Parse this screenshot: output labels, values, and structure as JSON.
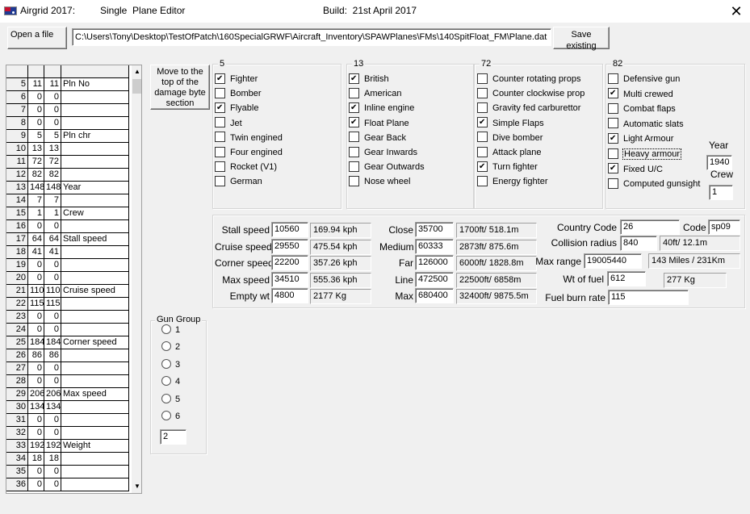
{
  "window": {
    "app": "Airgrid 2017:",
    "subtitle": "Single  Plane Editor",
    "build": "Build:  21st April 2017",
    "close_glyph": "✕"
  },
  "toolbar": {
    "open_label": "Open a file",
    "path": "C:\\Users\\Tony\\Desktop\\TestOfPatch\\160SpecialGRWF\\Aircraft_Inventory\\SPAWPlanes\\FMs\\140SpitFloat_FM\\Plane.dat",
    "save_label": "Save existing"
  },
  "damage_button": "Move to the top of the damage byte section",
  "grid": {
    "rows": [
      {
        "n": "5",
        "a": "11",
        "b": "11",
        "label": "Pln No"
      },
      {
        "n": "6",
        "a": "0",
        "b": "0",
        "label": ""
      },
      {
        "n": "7",
        "a": "0",
        "b": "0",
        "label": ""
      },
      {
        "n": "8",
        "a": "0",
        "b": "0",
        "label": ""
      },
      {
        "n": "9",
        "a": "5",
        "b": "5",
        "label": "Pln chr"
      },
      {
        "n": "10",
        "a": "13",
        "b": "13",
        "label": ""
      },
      {
        "n": "11",
        "a": "72",
        "b": "72",
        "label": ""
      },
      {
        "n": "12",
        "a": "82",
        "b": "82",
        "label": ""
      },
      {
        "n": "13",
        "a": "148",
        "b": "148",
        "label": "Year"
      },
      {
        "n": "14",
        "a": "7",
        "b": "7",
        "label": ""
      },
      {
        "n": "15",
        "a": "1",
        "b": "1",
        "label": "Crew"
      },
      {
        "n": "16",
        "a": "0",
        "b": "0",
        "label": ""
      },
      {
        "n": "17",
        "a": "64",
        "b": "64",
        "label": "Stall speed"
      },
      {
        "n": "18",
        "a": "41",
        "b": "41",
        "label": ""
      },
      {
        "n": "19",
        "a": "0",
        "b": "0",
        "label": ""
      },
      {
        "n": "20",
        "a": "0",
        "b": "0",
        "label": ""
      },
      {
        "n": "21",
        "a": "110",
        "b": "110",
        "label": "Cruise speed"
      },
      {
        "n": "22",
        "a": "115",
        "b": "115",
        "label": ""
      },
      {
        "n": "23",
        "a": "0",
        "b": "0",
        "label": ""
      },
      {
        "n": "24",
        "a": "0",
        "b": "0",
        "label": ""
      },
      {
        "n": "25",
        "a": "184",
        "b": "184",
        "label": "Corner speed"
      },
      {
        "n": "26",
        "a": "86",
        "b": "86",
        "label": ""
      },
      {
        "n": "27",
        "a": "0",
        "b": "0",
        "label": ""
      },
      {
        "n": "28",
        "a": "0",
        "b": "0",
        "label": ""
      },
      {
        "n": "29",
        "a": "206",
        "b": "206",
        "label": "Max speed"
      },
      {
        "n": "30",
        "a": "134",
        "b": "134",
        "label": ""
      },
      {
        "n": "31",
        "a": "0",
        "b": "0",
        "label": ""
      },
      {
        "n": "32",
        "a": "0",
        "b": "0",
        "label": ""
      },
      {
        "n": "33",
        "a": "192",
        "b": "192",
        "label": "Weight"
      },
      {
        "n": "34",
        "a": "18",
        "b": "18",
        "label": ""
      },
      {
        "n": "35",
        "a": "0",
        "b": "0",
        "label": ""
      },
      {
        "n": "36",
        "a": "0",
        "b": "0",
        "label": ""
      }
    ]
  },
  "groups": {
    "g5": {
      "title": "5",
      "items": [
        {
          "label": "Fighter",
          "checked": true
        },
        {
          "label": "Bomber",
          "checked": false
        },
        {
          "label": "Flyable",
          "checked": true
        },
        {
          "label": "Jet",
          "checked": false
        },
        {
          "label": "Twin engined",
          "checked": false
        },
        {
          "label": "Four engined",
          "checked": false
        },
        {
          "label": "Rocket (V1)",
          "checked": false
        },
        {
          "label": "German",
          "checked": false
        }
      ]
    },
    "g13": {
      "title": "13",
      "items": [
        {
          "label": "British",
          "checked": true
        },
        {
          "label": "American",
          "checked": false
        },
        {
          "label": "Inline engine",
          "checked": true
        },
        {
          "label": "Float Plane",
          "checked": true
        },
        {
          "label": "Gear Back",
          "checked": false
        },
        {
          "label": "Gear Inwards",
          "checked": false
        },
        {
          "label": "Gear Outwards",
          "checked": false
        },
        {
          "label": "Nose wheel",
          "checked": false
        }
      ]
    },
    "g72": {
      "title": "72",
      "items": [
        {
          "label": "Counter rotating props",
          "checked": false
        },
        {
          "label": "Counter clockwise prop",
          "checked": false
        },
        {
          "label": "Gravity fed carburettor",
          "checked": false
        },
        {
          "label": "Simple Flaps",
          "checked": true
        },
        {
          "label": "Dive bomber",
          "checked": false
        },
        {
          "label": "Attack plane",
          "checked": false
        },
        {
          "label": "Turn fighter",
          "checked": true
        },
        {
          "label": "Energy fighter",
          "checked": false
        }
      ]
    },
    "g82": {
      "title": "82",
      "items": [
        {
          "label": "Defensive gun",
          "checked": false
        },
        {
          "label": "Multi crewed",
          "checked": true
        },
        {
          "label": "Combat flaps",
          "checked": false
        },
        {
          "label": "Automatic slats",
          "checked": false
        },
        {
          "label": "Light Armour",
          "checked": true
        },
        {
          "label": "Heavy armour",
          "checked": false
        },
        {
          "label": "Fixed U/C",
          "checked": true
        },
        {
          "label": "Computed gunsight",
          "checked": false
        }
      ],
      "year_label": "Year",
      "year_value": "1940",
      "crew_label": "Crew",
      "crew_value": "1"
    }
  },
  "performance": {
    "speeds": [
      {
        "label": "Stall speed",
        "value": "10560",
        "conv": "169.94 kph"
      },
      {
        "label": "Cruise speed",
        "value": "29550",
        "conv": "475.54 kph"
      },
      {
        "label": "Corner speed",
        "value": "22200",
        "conv": "357.26 kph"
      },
      {
        "label": "Max speed",
        "value": "34510",
        "conv": "555.36 kph"
      },
      {
        "label": "Empty wt",
        "value": "4800",
        "conv": "2177 Kg"
      }
    ],
    "ranges": [
      {
        "label": "Close",
        "value": "35700",
        "conv": "1700ft/ 518.1m"
      },
      {
        "label": "Medium",
        "value": "60333",
        "conv": "2873ft/ 875.6m"
      },
      {
        "label": "Far",
        "value": "126000",
        "conv": "6000ft/ 1828.8m"
      },
      {
        "label": "Line",
        "value": "472500",
        "conv": "22500ft/ 6858m"
      },
      {
        "label": "Max",
        "value": "680400",
        "conv": "32400ft/ 9875.5m"
      }
    ],
    "country_label": "Country Code",
    "country_value": "26",
    "code_label": "Code",
    "code_value": "sp09",
    "collision_label": "Collision radius",
    "collision_value": "840",
    "collision_conv": "40ft/ 12.1m",
    "maxrange_label": "Max range",
    "maxrange_value": "19005440",
    "maxrange_conv": "143 Miles / 231Km",
    "fuel_label": "Wt of fuel",
    "fuel_value": "612",
    "fuel_conv": "277 Kg",
    "burn_label": "Fuel burn rate",
    "burn_value": "115"
  },
  "gun_group": {
    "title": "Gun Group",
    "options": [
      "1",
      "2",
      "3",
      "4",
      "5",
      "6"
    ],
    "value": "2"
  }
}
